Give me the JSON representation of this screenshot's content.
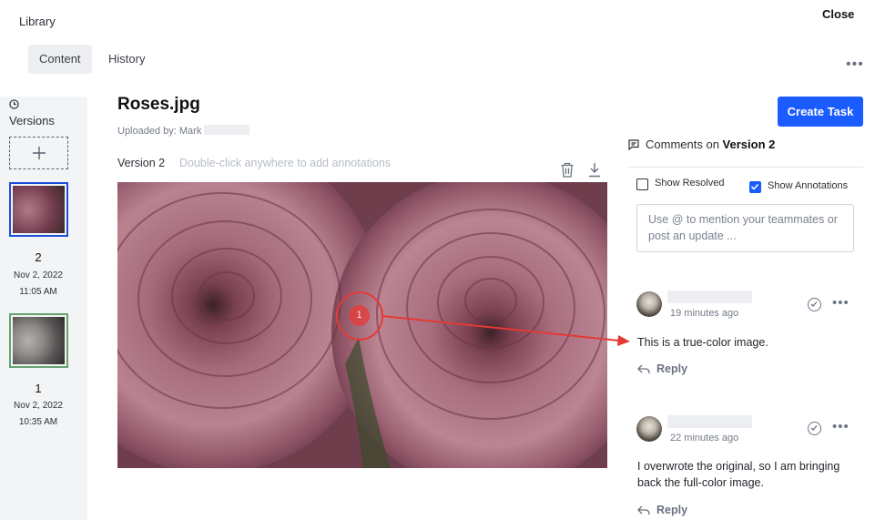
{
  "header": {
    "title": "Library",
    "close_label": "Close",
    "tabs": [
      {
        "label": "Content",
        "active": true
      },
      {
        "label": "History",
        "active": false
      }
    ],
    "more_icon": "more-horizontal-icon"
  },
  "sidebar": {
    "heading": "Versions",
    "heading_icon": "clock-icon",
    "add_icon": "plus-icon",
    "versions": [
      {
        "number": "2",
        "date": "Nov 2, 2022",
        "time": "11:05 AM",
        "selected": true
      },
      {
        "number": "1",
        "date": "Nov 2, 2022",
        "time": "10:35 AM",
        "selected": false
      }
    ]
  },
  "file": {
    "name": "Roses.jpg",
    "uploaded_by": "Uploaded by: Mark",
    "version_label": "Version 2",
    "annotation_hint": "Double-click anywhere to add annotations"
  },
  "annotation": {
    "marker_number": "1"
  },
  "comments": {
    "create_task_label": "Create Task",
    "header_prefix": "Comments on",
    "header_version": "Version 2",
    "show_resolved_label": "Show Resolved",
    "show_resolved_checked": false,
    "show_annotations_label": "Show Annotations",
    "show_annotations_checked": true,
    "input_placeholder": "Use @ to mention your teammates or post an update ...",
    "items": [
      {
        "time": "19 minutes ago",
        "text": "This is a true-color image.",
        "reply_label": "Reply"
      },
      {
        "time": "22 minutes ago",
        "text": "I overwrote the original, so I am bringing back the full-color image.",
        "reply_label": "Reply"
      }
    ]
  },
  "colors": {
    "accent": "#1a5cff",
    "annotation": "#e53935",
    "selected_border": "#1d4ed8",
    "version1_border": "#65a36b"
  }
}
